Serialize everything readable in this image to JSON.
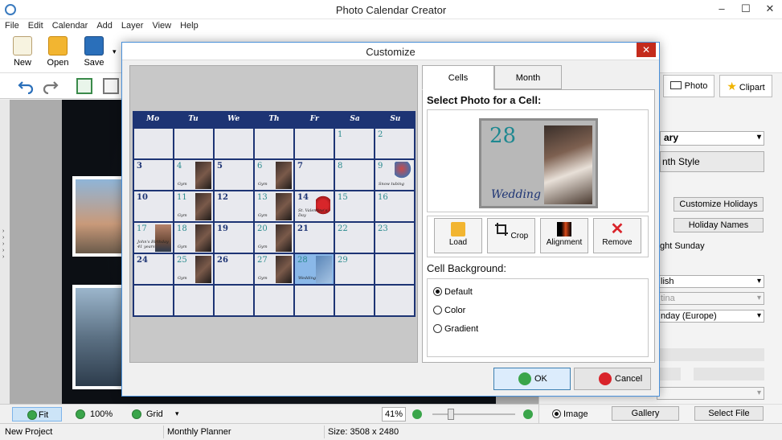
{
  "window": {
    "title": "Photo Calendar Creator",
    "menu": [
      "File",
      "Edit",
      "Calendar",
      "Add",
      "Layer",
      "View",
      "Help"
    ],
    "toolbar": {
      "new": "New",
      "open": "Open",
      "save": "Save"
    }
  },
  "right_panel": {
    "tabs": {
      "photo": "Photo",
      "clipart": "Clipart"
    },
    "month_select": "ary",
    "month_style": "nth Style",
    "customize_holidays": "Customize Holidays",
    "holiday_names": "Holiday Names",
    "highlight_sunday": "ght Sunday",
    "language_select": "lish",
    "country_select": "tina",
    "week_select": "nday (Europe)",
    "image_radio": "Image",
    "gallery": "Gallery",
    "select_file": "Select File"
  },
  "zoom": {
    "fit": "Fit",
    "p100": "100%",
    "grid": "Grid",
    "level": "41%"
  },
  "status": {
    "project": "New Project",
    "template": "Monthly Planner",
    "size": "Size: 3508 x 2480"
  },
  "dialog": {
    "title": "Customize",
    "tabs": [
      "Cells",
      "Month"
    ],
    "select_photo_title": "Select Photo for a Cell:",
    "sample": {
      "number": "28",
      "caption": "Wedding"
    },
    "tools": [
      "Load",
      "Crop",
      "Alignment",
      "Remove"
    ],
    "cell_background_title": "Cell Background:",
    "backgrounds": [
      "Default",
      "Color",
      "Gradient"
    ],
    "ok": "OK",
    "cancel": "Cancel"
  },
  "calendar": {
    "weekdays": [
      "Mo",
      "Tu",
      "We",
      "Th",
      "Fr",
      "Sa",
      "Su"
    ],
    "cells": [
      {
        "d": ""
      },
      {
        "d": ""
      },
      {
        "d": ""
      },
      {
        "d": ""
      },
      {
        "d": ""
      },
      {
        "d": "1",
        "teal": true
      },
      {
        "d": "2",
        "teal": true
      },
      {
        "d": "3"
      },
      {
        "d": "4",
        "teal": true,
        "ev": "Gym",
        "ph": "ph"
      },
      {
        "d": "5"
      },
      {
        "d": "6",
        "teal": true,
        "ev": "Gym",
        "ph": "ph"
      },
      {
        "d": "7"
      },
      {
        "d": "8",
        "teal": true
      },
      {
        "d": "9",
        "teal": true,
        "ev": "Snow tubing",
        "ph": "ph-cart"
      },
      {
        "d": "10"
      },
      {
        "d": "11",
        "teal": true,
        "ev": "Gym",
        "ph": "ph"
      },
      {
        "d": "12"
      },
      {
        "d": "13",
        "teal": true,
        "ev": "Gym",
        "ph": "ph"
      },
      {
        "d": "14",
        "ev": "St. Valentine's Day",
        "ph": "ph-bear"
      },
      {
        "d": "15",
        "teal": true
      },
      {
        "d": "16",
        "teal": true
      },
      {
        "d": "17",
        "teal": true,
        "ev": "John's Birthday 41 years",
        "ph": "ph-man"
      },
      {
        "d": "18",
        "teal": true,
        "ev": "Gym",
        "ph": "ph"
      },
      {
        "d": "19"
      },
      {
        "d": "20",
        "teal": true,
        "ev": "Gym",
        "ph": "ph"
      },
      {
        "d": "21"
      },
      {
        "d": "22",
        "teal": true
      },
      {
        "d": "23",
        "teal": true
      },
      {
        "d": "24"
      },
      {
        "d": "25",
        "teal": true,
        "ev": "Gym",
        "ph": "ph"
      },
      {
        "d": "26"
      },
      {
        "d": "27",
        "teal": true,
        "ev": "Gym",
        "ph": "ph"
      },
      {
        "d": "28",
        "teal": true,
        "ev": "Wedding",
        "ph": "ph-blue",
        "sel": true
      },
      {
        "d": "29",
        "teal": true
      },
      {
        "d": ""
      },
      {
        "d": ""
      },
      {
        "d": ""
      },
      {
        "d": ""
      },
      {
        "d": ""
      },
      {
        "d": ""
      },
      {
        "d": ""
      },
      {
        "d": ""
      }
    ]
  }
}
